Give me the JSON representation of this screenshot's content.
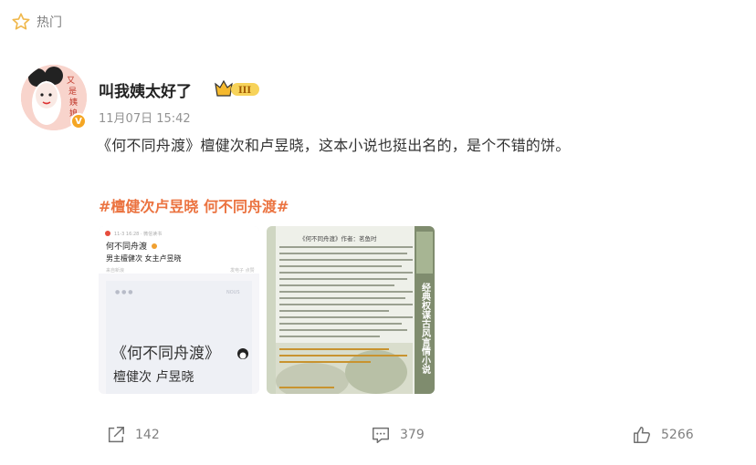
{
  "header": {
    "hot_label": "热门"
  },
  "post": {
    "username": "叫我姨太好了",
    "vip_level": "III",
    "time": "11月07日 15:42",
    "text": "《何不同舟渡》檀健次和卢昱晓，这本小说也挺出名的，是个不错的饼。",
    "hashtag": "#檀健次卢昱晓 何不同舟渡#",
    "avatar_text": "又是姨娘"
  },
  "images": [
    {
      "meta_line": "11-3 16:28 · 微信读书",
      "title": "何不同舟渡",
      "subtitle": "男主檀健次 女主卢昱晓",
      "small_right": "发电子 点赞",
      "small_left": "来自新浪",
      "poster_corner": "NOUS",
      "poster_title": "《何不同舟渡》",
      "poster_sub": "檀健次 卢昱晓"
    },
    {
      "title": "《何不同舟渡》作者：茗鱼时",
      "side_text": "经典权谋古风言情小说"
    }
  ],
  "actions": {
    "shares": "142",
    "comments": "379",
    "likes": "5266"
  },
  "colors": {
    "accent": "#eb7340",
    "meta_gray": "#939393",
    "icon_gray": "#808080",
    "vip_gold": "#f5b92e"
  }
}
